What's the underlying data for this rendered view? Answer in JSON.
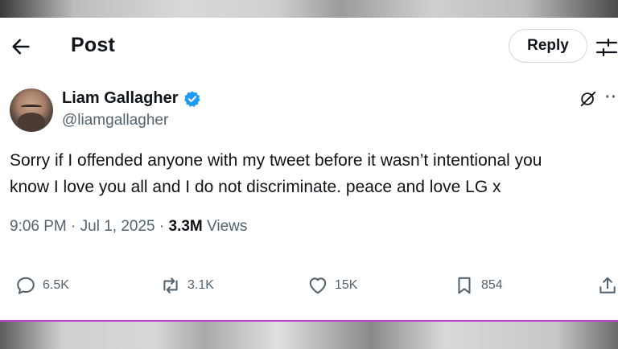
{
  "header": {
    "title": "Post",
    "reply_label": "Reply"
  },
  "author": {
    "name": "Liam Gallagher",
    "handle": "@liamgallagher",
    "verified_color": "#1d9bf0"
  },
  "tweet": {
    "lines": [
      "Sorry if I offended anyone with my tweet before it wasn’t intentional you",
      "know I love you all and I do not discriminate. peace and love LG x"
    ]
  },
  "meta": {
    "time": "9:06 PM",
    "date": "Jul 1, 2025",
    "views_count": "3.3M",
    "views_label": "Views"
  },
  "actions": {
    "replies": "6.5K",
    "reposts": "3.1K",
    "likes": "15K",
    "bookmarks": "854"
  },
  "icons": {
    "back": "arrow-left-icon",
    "settings": "sliders-icon",
    "verified": "verified-badge-icon",
    "grok": "grok-icon",
    "more": "more-icon",
    "reply": "comment-icon",
    "repost": "repost-icon",
    "like": "heart-icon",
    "bookmark": "bookmark-icon",
    "share": "share-icon"
  }
}
